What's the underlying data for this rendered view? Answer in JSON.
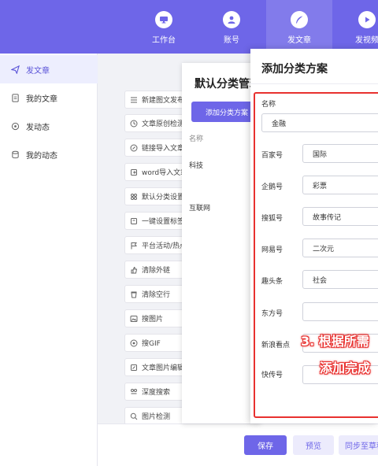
{
  "topnav": {
    "items": [
      {
        "label": "工作台",
        "icon": "monitor-icon"
      },
      {
        "label": "账号",
        "icon": "user-icon"
      },
      {
        "label": "发文章",
        "icon": "feather-icon"
      },
      {
        "label": "发视频",
        "icon": "play-icon"
      }
    ],
    "active": "发文章"
  },
  "sidebar": {
    "items": [
      {
        "label": "发文章",
        "icon": "send-icon"
      },
      {
        "label": "我的文章",
        "icon": "document-icon"
      },
      {
        "label": "发动态",
        "icon": "target-icon"
      },
      {
        "label": "我的动态",
        "icon": "database-icon"
      }
    ]
  },
  "tools": [
    "新建图文发布",
    "文章原创检测",
    "链接导入文章",
    "word导入文章",
    "默认分类设置",
    "一键设置标签",
    "平台活动/热点",
    "清除外链",
    "清除空行",
    "搜图片",
    "搜GIF",
    "文章图片编辑",
    "深度搜索",
    "图片检测"
  ],
  "footer": {
    "save": "保存",
    "preview": "预览",
    "sync": "同步至草稿"
  },
  "default_dialog": {
    "title": "默认分类管理",
    "add_button": "添加分类方案",
    "column_name": "名称",
    "rows": [
      "科技",
      "互联网"
    ]
  },
  "add_dialog": {
    "title": "添加分类方案",
    "name_label": "名称",
    "name_value": "金融",
    "fields": [
      {
        "label": "百家号",
        "value": "国际"
      },
      {
        "label": "企鹅号",
        "value": "彩票"
      },
      {
        "label": "搜狐号",
        "value": "故事传记"
      },
      {
        "label": "网易号",
        "value": "二次元"
      },
      {
        "label": "趣头条",
        "value": "社会"
      },
      {
        "label": "东方号",
        "value": ""
      },
      {
        "label": "新浪看点",
        "value": ""
      },
      {
        "label": "快传号",
        "value": ""
      }
    ]
  },
  "annotation": {
    "line1": "3. 根据所需",
    "line2": "添加完成"
  },
  "colors": {
    "primary": "#6e66e8",
    "highlight": "#e8312f"
  }
}
